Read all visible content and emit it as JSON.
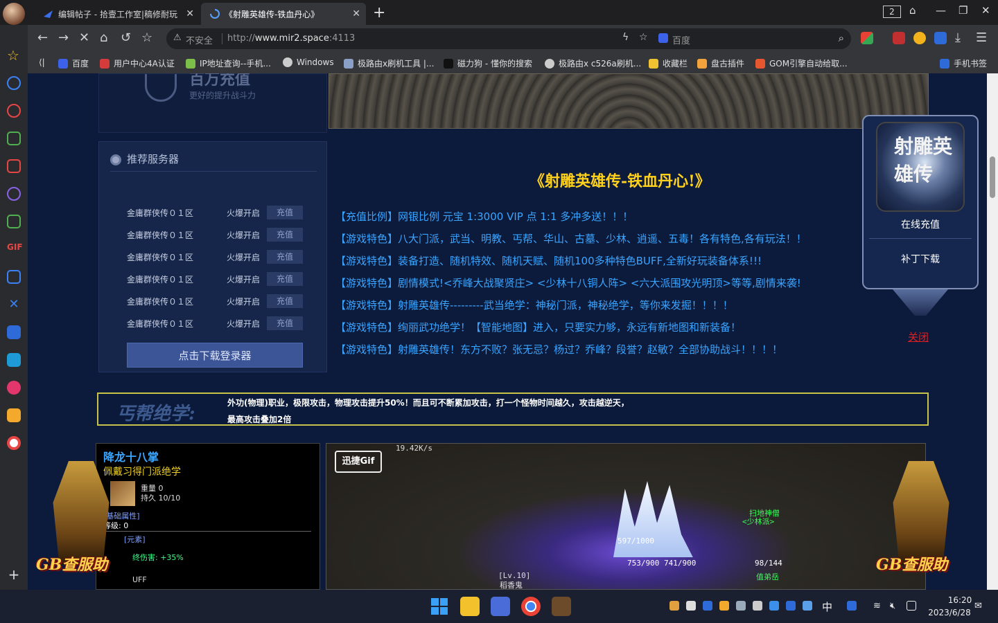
{
  "browser": {
    "tabs": [
      {
        "title": "编辑帖子 - 拾壹工作室|稿修耐玩",
        "active": false
      },
      {
        "title": "《射雕英雄传-铁血丹心》",
        "active": true
      }
    ],
    "tab_count": "2",
    "address": {
      "security_label": "不安全",
      "url_prefix": "http://",
      "url_host": "www.mir2.space",
      "url_port": ":4113"
    },
    "search_placeholder": "百度",
    "bookmarks": [
      {
        "label": "百度",
        "icon": "baidu-icon",
        "color": "#3b62e8"
      },
      {
        "label": "用户中心4A认证",
        "icon": "user-center-icon",
        "color": "#d43b3b"
      },
      {
        "label": "IP地址查询--手机...",
        "icon": "ip-icon",
        "color": "#7cc04a"
      },
      {
        "label": "Windows",
        "icon": "globe-icon",
        "color": "#cccccc"
      },
      {
        "label": "极路由x刷机工具 |...",
        "icon": "doc-icon",
        "color": "#8aa0c8"
      },
      {
        "label": "磁力狗 - 懂你的搜索",
        "icon": "dog-icon",
        "color": "#222222"
      },
      {
        "label": "极路由x c526a刷机...",
        "icon": "globe-icon",
        "color": "#cccccc"
      },
      {
        "label": "收藏栏",
        "icon": "folder-icon",
        "color": "#f1c232"
      },
      {
        "label": "盘古插件",
        "icon": "pangu-icon",
        "color": "#f3a33b"
      },
      {
        "label": "GOM引擎自动给取...",
        "icon": "gom-icon",
        "color": "#e6562f"
      }
    ],
    "mobile_bookmarks": "手机书签"
  },
  "page": {
    "recharge_title": "百万充值",
    "recharge_sub": "更好的提升战斗力",
    "server_header": "推荐服务器",
    "servers": [
      {
        "name": "金庸群侠传０１区",
        "tag": "火爆开启",
        "button": "充值"
      },
      {
        "name": "金庸群侠传０１区",
        "tag": "火爆开启",
        "button": "充值"
      },
      {
        "name": "金庸群侠传０１区",
        "tag": "火爆开启",
        "button": "充值"
      },
      {
        "name": "金庸群侠传０１区",
        "tag": "火爆开启",
        "button": "充值"
      },
      {
        "name": "金庸群侠传０１区",
        "tag": "火爆开启",
        "button": "充值"
      },
      {
        "name": "金庸群侠传０１区",
        "tag": "火爆开启",
        "button": "充值"
      }
    ],
    "download_button": "点击下载登录器",
    "game_title": "《射雕英雄传-铁血丹心!》",
    "features": [
      "【充值比例】网银比例 元宝 1:3000 VIP 点 1:1 多冲多送！！！",
      "【游戏特色】八大门派，武当、明教、丐帮、华山、古墓、少林、逍遥、五毒！各有特色,各有玩法！！",
      "【游戏特色】装备打造、随机特效、随机天赋、随机100多种特色BUFF,全新好玩装备体系!!!",
      "【游戏特色】剧情模式!<乔峰大战聚贤庄> <少林十八铜人阵> <六大派围攻光明顶>等等,剧情来袭!",
      "【游戏特色】射雕英雄传---------武当绝学：神秘门派，神秘绝学，等你来发掘！！！！",
      "【游戏特色】绚丽武功绝学！【智能地图】进入，只要实力够，永远有新地图和新装备！",
      "【游戏特色】射雕英雄传！东方不败？张无忌？杨过？乔峰？段誉？赵敏？全部协助战斗！！！！"
    ],
    "float": {
      "portrait_text": "射雕英雄传",
      "recharge": "在线充值",
      "download": "补丁下载",
      "close": "关闭"
    },
    "skill_banner": {
      "label": "丐帮绝学:",
      "line1": "外功(物理)职业，极限攻击，物理攻击提升50%！而且可不断累加攻击，打一个怪物时间越久，攻击越逆天，",
      "line2": "最高攻击叠加2倍"
    },
    "skill_box": {
      "name": "降龙十八掌",
      "requirement": "佩戴习得门派绝学",
      "weight": "重量 0",
      "durability": "持久 10/10",
      "attr_head": "[基础属性]",
      "level": "等级: 0",
      "element": "[元素]",
      "damage": "终伤害: +35%",
      "buff": "UFF"
    },
    "game_shot": {
      "speed": "19.42K/s",
      "gif_badge": "迅捷Gif",
      "texts": [
        {
          "text": "扫地神僧",
          "color": "#3aff5a"
        },
        {
          "text": "<少林派>",
          "color": "#3aff5a"
        },
        {
          "text": "597/1000",
          "color": "#ffffff"
        },
        {
          "text": "753/900  741/900",
          "color": "#ffffff"
        },
        {
          "text": "98/144",
          "color": "#ffffff"
        },
        {
          "text": "[Lv.10]",
          "color": "#dddddd"
        },
        {
          "text": "稻香鬼",
          "color": "#dddddd"
        },
        {
          "text": "值弟岳",
          "color": "#3aff5a"
        }
      ]
    },
    "mascot_text": "GB查服助"
  },
  "taskbar": {
    "ime": "中",
    "time": "16:20",
    "date": "2023/6/28"
  }
}
